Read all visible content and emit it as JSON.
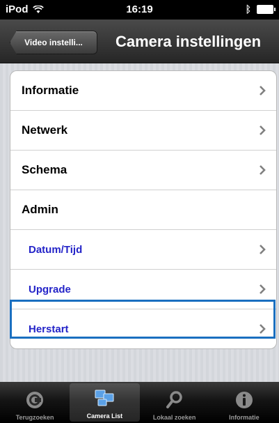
{
  "statusbar": {
    "carrier": "iPod",
    "time": "16:19"
  },
  "navbar": {
    "back_label": "Video instelli...",
    "title": "Camera instellingen"
  },
  "list": {
    "items": [
      {
        "label": "Informatie"
      },
      {
        "label": "Netwerk"
      },
      {
        "label": "Schema"
      },
      {
        "label": "Admin"
      },
      {
        "label": "Datum/Tijd"
      },
      {
        "label": "Upgrade"
      },
      {
        "label": "Herstart"
      }
    ]
  },
  "tabbar": {
    "tabs": [
      {
        "label": "Terugzoeken",
        "icon": "back-circle-icon"
      },
      {
        "label": "Camera List",
        "icon": "camera-list-icon"
      },
      {
        "label": "Lokaal zoeken",
        "icon": "magnifier-icon"
      },
      {
        "label": "Informatie",
        "icon": "info-icon"
      }
    ]
  },
  "colors": {
    "accent_sub_item": "#2424c8",
    "highlight_border": "#1a6fc0"
  }
}
